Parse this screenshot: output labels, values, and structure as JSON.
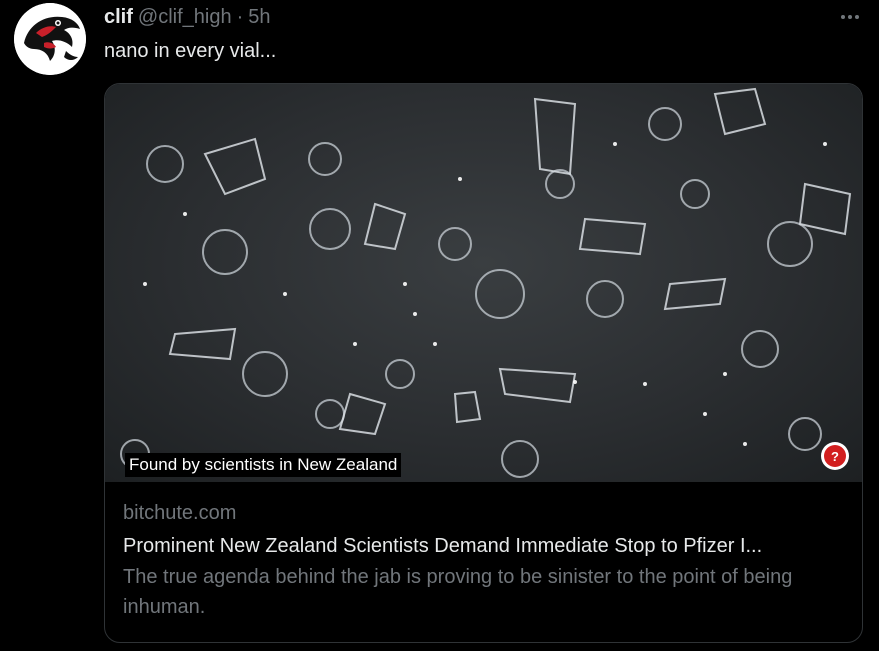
{
  "tweet": {
    "author_name": "clif",
    "author_handle": "@clif_high",
    "separator": "·",
    "timestamp": "5h",
    "text": "nano in every vial..."
  },
  "card": {
    "caption": "Found by scientists in New Zealand",
    "badge": "?",
    "domain": "bitchute.com",
    "title": "Prominent New Zealand Scientists Demand Immediate Stop to Pfizer I...",
    "description": "The true agenda behind the jab is proving to be sinister to the point of being inhuman."
  },
  "icons": {
    "more": "more-horizontal-icon",
    "avatar": "raven-logo-avatar",
    "badge": "help-question-icon"
  },
  "colors": {
    "background": "#000000",
    "primary_text": "#e7e9ea",
    "secondary_text": "#71767b",
    "border": "#2f3336",
    "badge_red": "#d21f1f"
  }
}
